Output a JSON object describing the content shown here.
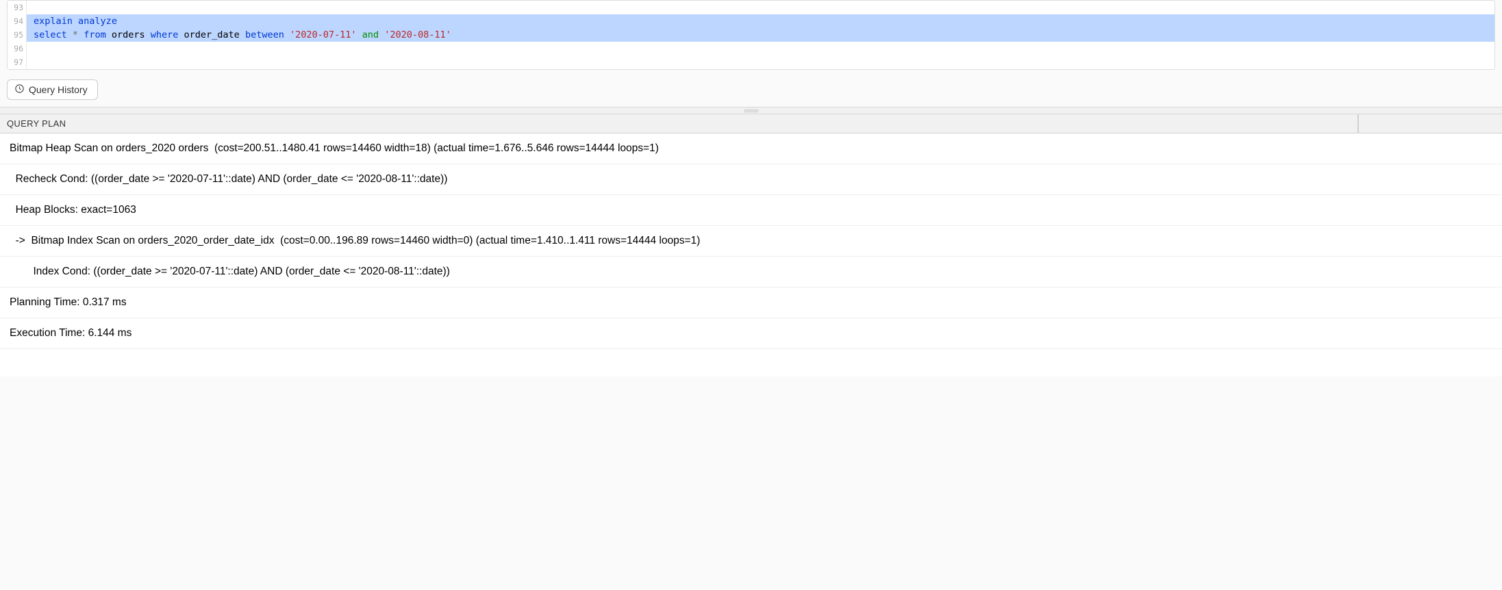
{
  "editor": {
    "lines": [
      {
        "num": "93",
        "highlighted": false,
        "tokens": []
      },
      {
        "num": "94",
        "highlighted": true,
        "tokens": [
          {
            "cls": "kw-blue",
            "text": "explain"
          },
          {
            "cls": "plain",
            "text": " "
          },
          {
            "cls": "kw-blue",
            "text": "analyze"
          }
        ]
      },
      {
        "num": "95",
        "highlighted": true,
        "tokens": [
          {
            "cls": "kw-blue",
            "text": "select"
          },
          {
            "cls": "plain",
            "text": " "
          },
          {
            "cls": "kw-gray",
            "text": "*"
          },
          {
            "cls": "plain",
            "text": " "
          },
          {
            "cls": "kw-blue",
            "text": "from"
          },
          {
            "cls": "plain",
            "text": " orders "
          },
          {
            "cls": "kw-blue",
            "text": "where"
          },
          {
            "cls": "plain",
            "text": " order_date "
          },
          {
            "cls": "kw-blue",
            "text": "between"
          },
          {
            "cls": "plain",
            "text": " "
          },
          {
            "cls": "str-red",
            "text": "'2020-07-11'"
          },
          {
            "cls": "plain",
            "text": " "
          },
          {
            "cls": "kw-green",
            "text": "and"
          },
          {
            "cls": "plain",
            "text": " "
          },
          {
            "cls": "str-red",
            "text": "'2020-08-11'"
          }
        ]
      },
      {
        "num": "96",
        "highlighted": false,
        "tokens": []
      },
      {
        "num": "97",
        "highlighted": false,
        "tokens": []
      }
    ]
  },
  "toolbar": {
    "query_history_label": "Query History"
  },
  "results": {
    "header": "QUERY PLAN",
    "rows": [
      "Bitmap Heap Scan on orders_2020 orders  (cost=200.51..1480.41 rows=14460 width=18) (actual time=1.676..5.646 rows=14444 loops=1)",
      "  Recheck Cond: ((order_date >= '2020-07-11'::date) AND (order_date <= '2020-08-11'::date))",
      "  Heap Blocks: exact=1063",
      "  ->  Bitmap Index Scan on orders_2020_order_date_idx  (cost=0.00..196.89 rows=14460 width=0) (actual time=1.410..1.411 rows=14444 loops=1)",
      "        Index Cond: ((order_date >= '2020-07-11'::date) AND (order_date <= '2020-08-11'::date))",
      "Planning Time: 0.317 ms",
      "Execution Time: 6.144 ms"
    ]
  }
}
